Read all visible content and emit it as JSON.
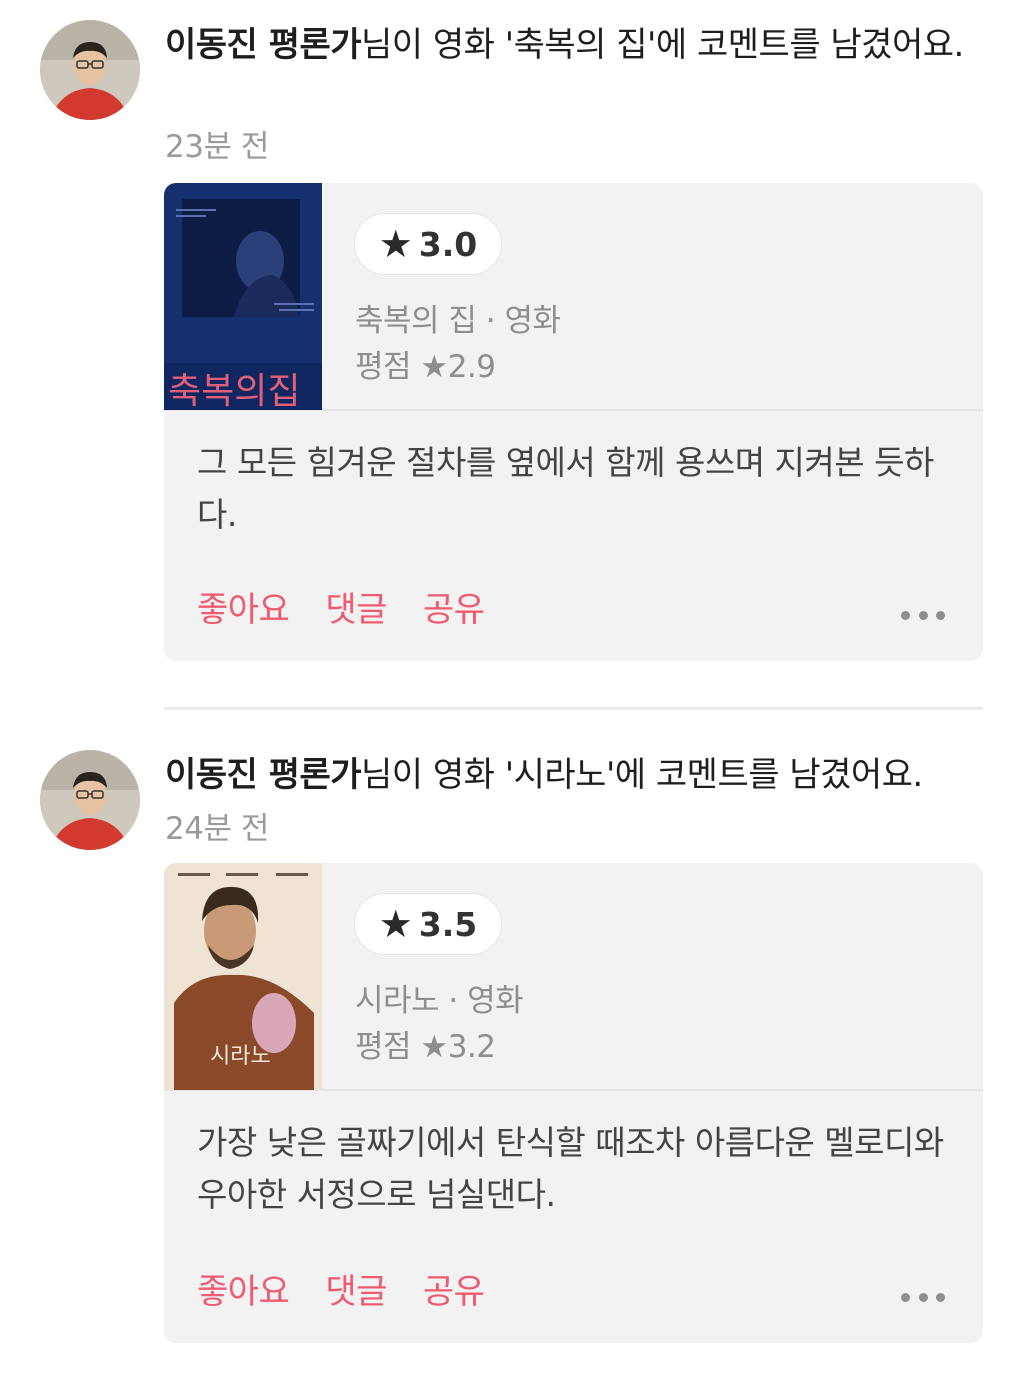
{
  "posts": [
    {
      "author": "이동진 평론가",
      "action_text": "님이 영화 '축복의 집'에 코멘트를 남겼어요.",
      "time": "23분 전",
      "my_rating": "3.0",
      "movie_line": "축복의 집 · 영화",
      "avg_label": "평점",
      "avg_rating": "2.9",
      "poster_title": "축복의집",
      "comment": "그 모든 힘겨운 절차를 옆에서 함께 용쓰며 지켜본 듯하다.",
      "actions": {
        "like": "좋아요",
        "comment": "댓글",
        "share": "공유"
      }
    },
    {
      "author": "이동진 평론가",
      "action_text": "님이 영화 '시라노'에 코멘트를 남겼어요.",
      "time": "24분 전",
      "my_rating": "3.5",
      "movie_line": "시라노 · 영화",
      "avg_label": "평점",
      "avg_rating": "3.2",
      "poster_title": "시라노",
      "comment": "가장 낮은 골짜기에서 탄식할 때조차 아름다운 멜로디와 우아한 서정으로 넘실댄다.",
      "actions": {
        "like": "좋아요",
        "comment": "댓글",
        "share": "공유"
      }
    }
  ],
  "icons": {
    "star": "star-icon",
    "more": "more-horizontal-icon"
  },
  "colors": {
    "accent": "#f05a70",
    "card_bg": "#f2f2f2",
    "muted": "#8e8e8e"
  }
}
